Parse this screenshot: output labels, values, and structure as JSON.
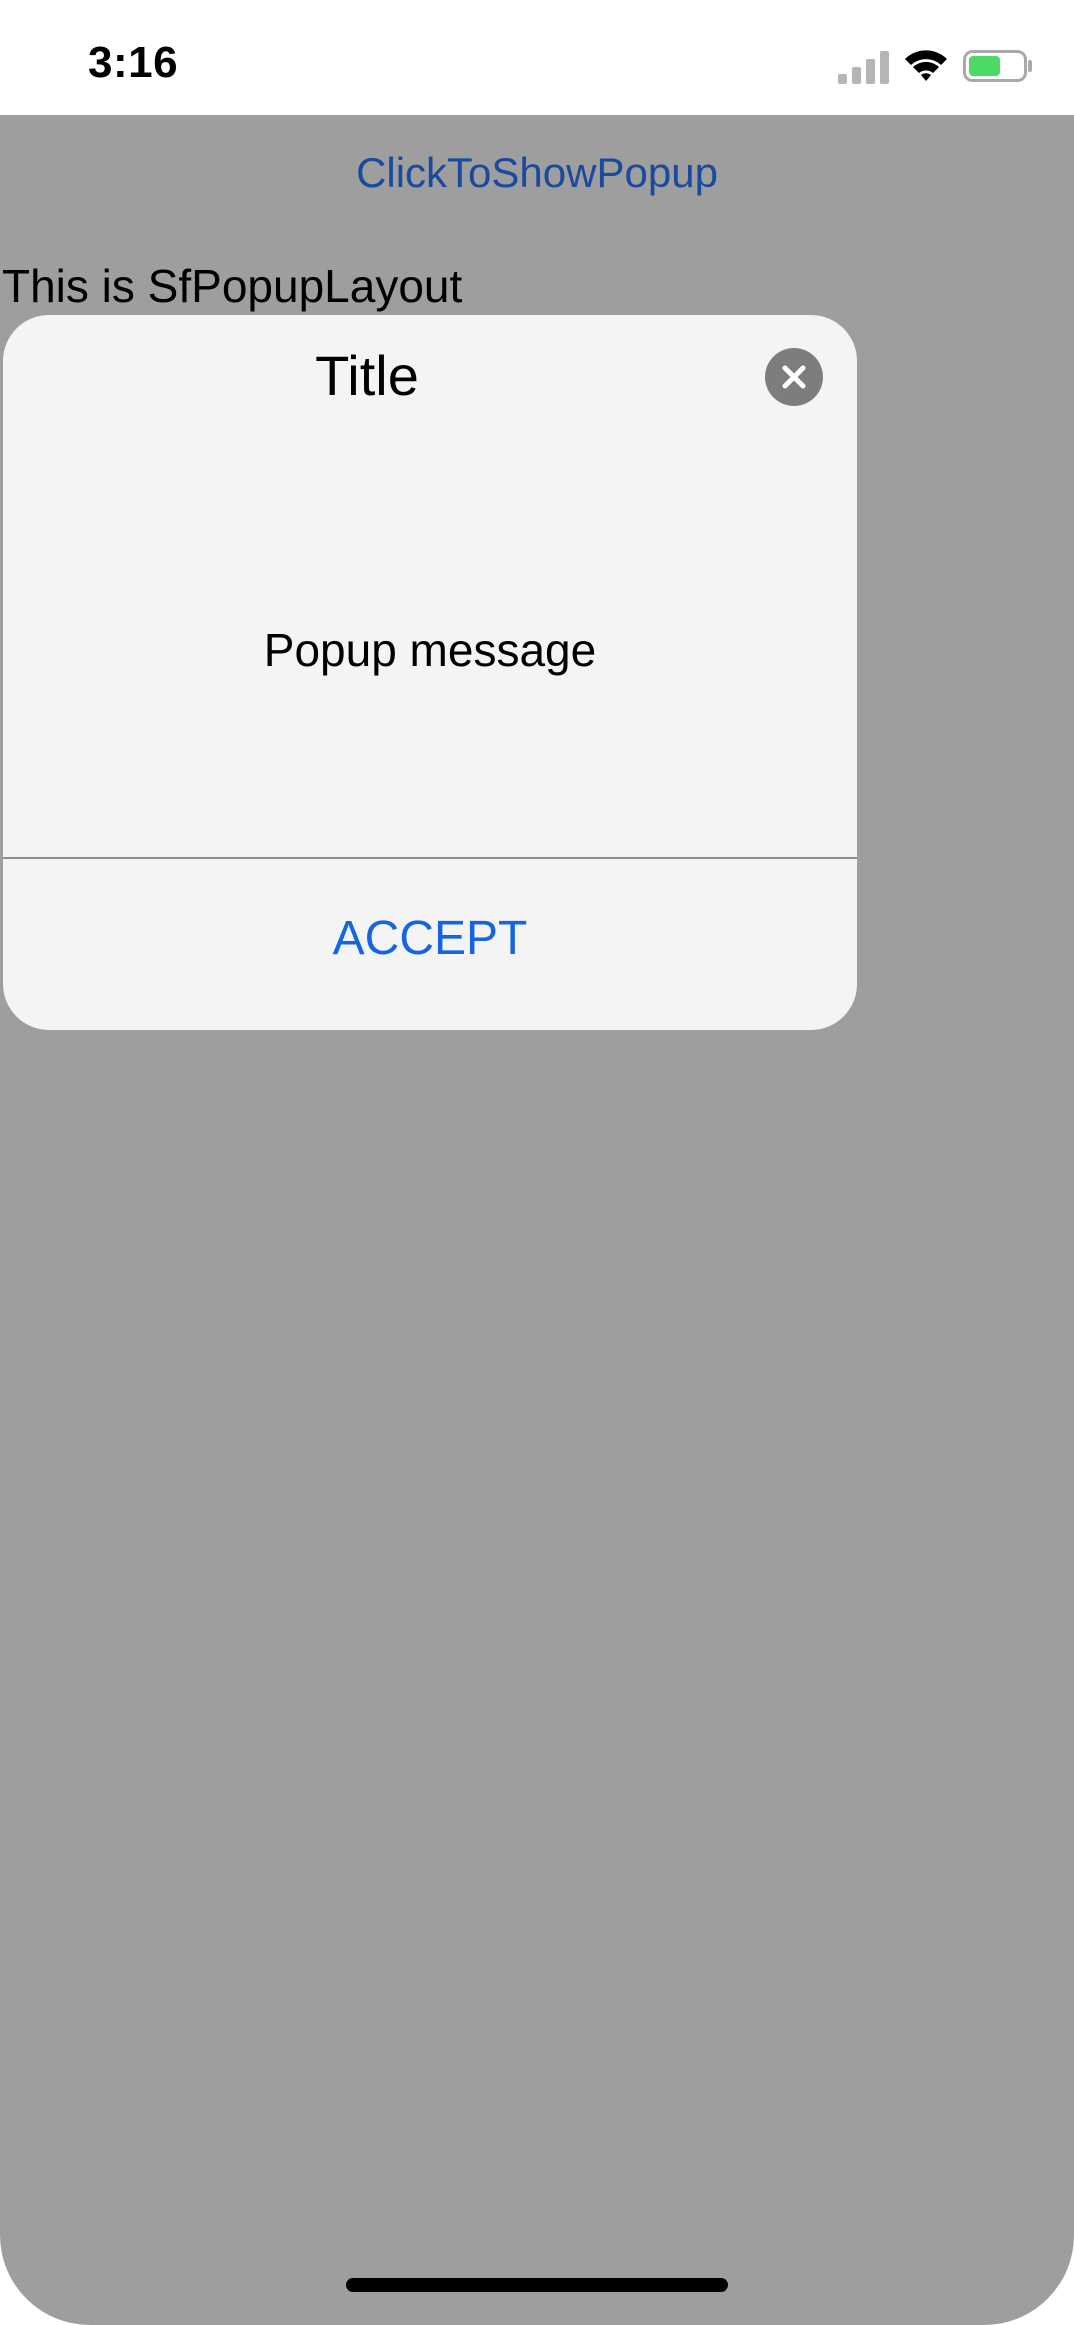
{
  "status_bar": {
    "time": "3:16",
    "icons": [
      "signal-icon",
      "wifi-icon",
      "battery-icon"
    ],
    "battery_color": "#4cd964"
  },
  "main": {
    "show_popup_button": "ClickToShowPopup",
    "layout_label": "This is SfPopupLayout"
  },
  "popup": {
    "title": "Title",
    "message": "Popup message",
    "accept_button": "ACCEPT",
    "close_icon": "close-icon"
  },
  "colors": {
    "backdrop": "#9e9e9e",
    "popup_background": "#f4f4f4",
    "link": "#1a4a9e",
    "accept": "#1565e0"
  }
}
